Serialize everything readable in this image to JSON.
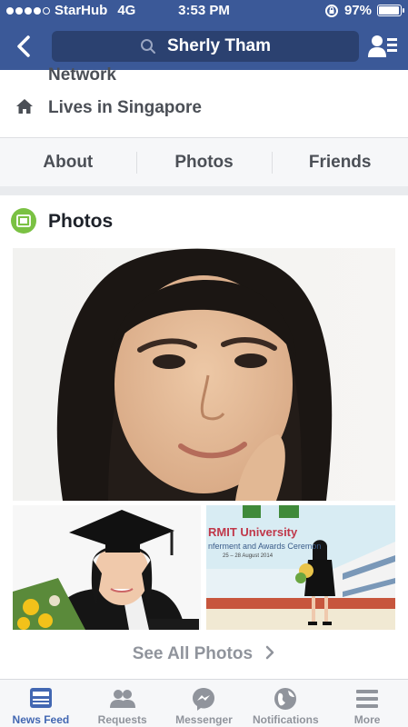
{
  "status_bar": {
    "carrier": "StarHub",
    "network": "4G",
    "time": "3:53 PM",
    "battery": "97%",
    "battery_level": 0.97
  },
  "header": {
    "search_text": "Sherly Tham"
  },
  "profile_info": {
    "network_label": "Network",
    "lives_in": "Lives in Singapore"
  },
  "tabs": [
    {
      "label": "About"
    },
    {
      "label": "Photos"
    },
    {
      "label": "Friends"
    }
  ],
  "photos_section": {
    "title": "Photos",
    "thumb_right_text": "RMIT University",
    "thumb_right_subtext": "nferment and Awards Ceremon",
    "thumb_right_date": "25 – 28 August 2014",
    "see_all": "See All Photos"
  },
  "bottom_nav": [
    {
      "label": "News Feed",
      "icon": "news-feed-icon",
      "active": true
    },
    {
      "label": "Requests",
      "icon": "requests-icon",
      "active": false
    },
    {
      "label": "Messenger",
      "icon": "messenger-icon",
      "active": false
    },
    {
      "label": "Notifications",
      "icon": "globe-icon",
      "active": false
    },
    {
      "label": "More",
      "icon": "menu-icon",
      "active": false
    }
  ],
  "colors": {
    "brand": "#3b5998",
    "active_nav": "#4267b2",
    "photos_icon": "#7ac143"
  }
}
